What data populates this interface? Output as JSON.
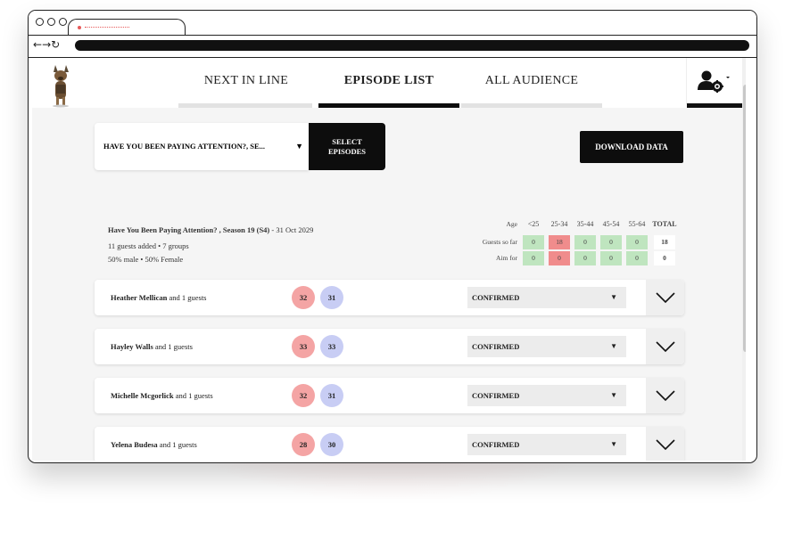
{
  "nav": {
    "tabs": [
      {
        "label": "NEXT IN LINE",
        "active": false
      },
      {
        "label": "EPISODE LIST",
        "active": true
      },
      {
        "label": "ALL AUDIENCE",
        "active": false
      }
    ],
    "user_icon": "user-gear-icon"
  },
  "episode_select": {
    "value": "HAVE YOU BEEN PAYING ATTENTION?, SE...",
    "select_button": "SELECT EPISODES"
  },
  "download_button": "DOWNLOAD DATA",
  "episode": {
    "title": "Have You Been Paying Attention? , Season 19 (S4)",
    "date": " - 31 Oct 2029",
    "guests_groups": "11 guests added • 7 groups",
    "gender": "50% male • 50% Female"
  },
  "stats": {
    "age_label": "Age",
    "columns": [
      "<25",
      "25-34",
      "35-44",
      "45-54",
      "55-64"
    ],
    "total_label": "TOTAL",
    "rows": [
      {
        "label": "Guests so far",
        "values": [
          "0",
          "18",
          "0",
          "0",
          "0"
        ],
        "total": "18"
      },
      {
        "label": "Aim for",
        "values": [
          "0",
          "0",
          "0",
          "0",
          "0"
        ],
        "total": "0"
      }
    ]
  },
  "guests": [
    {
      "name": "Heather Mellican",
      "suffix": " and 1 guests",
      "badge1": "32",
      "badge2": "31",
      "status": "CONFIRMED"
    },
    {
      "name": "Hayley Walls",
      "suffix": " and 1 guests",
      "badge1": "33",
      "badge2": "33",
      "status": "CONFIRMED"
    },
    {
      "name": "Michelle Mcgorlick",
      "suffix": " and 1 guests",
      "badge1": "32",
      "badge2": "31",
      "status": "CONFIRMED"
    },
    {
      "name": "Yelena Budesa",
      "suffix": " and 1 guests",
      "badge1": "28",
      "badge2": "30",
      "status": "CONFIRMED"
    }
  ],
  "colors": {
    "accent": "#0d0d0d",
    "red": "#f08c8c",
    "green": "#bfe5bf",
    "badge_pink": "#f4a4a4",
    "badge_blue": "#c8cdf4"
  }
}
